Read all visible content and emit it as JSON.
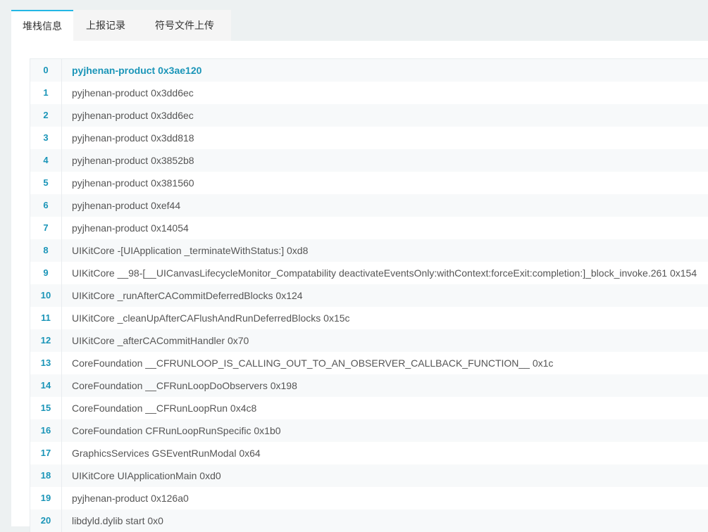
{
  "tabs": [
    {
      "label": "堆栈信息",
      "active": true
    },
    {
      "label": "上报记录",
      "active": false
    },
    {
      "label": "符号文件上传",
      "active": false
    }
  ],
  "colors": {
    "accent": "#23b7e5",
    "index_text": "#1a95b8",
    "page_bg": "#edf1f2",
    "row_alt": "#f7f9fa"
  },
  "stack": [
    {
      "index": "0",
      "frame": "pyjhenan-product 0x3ae120",
      "highlight": true
    },
    {
      "index": "1",
      "frame": "pyjhenan-product 0x3dd6ec"
    },
    {
      "index": "2",
      "frame": "pyjhenan-product 0x3dd6ec"
    },
    {
      "index": "3",
      "frame": "pyjhenan-product 0x3dd818"
    },
    {
      "index": "4",
      "frame": "pyjhenan-product 0x3852b8"
    },
    {
      "index": "5",
      "frame": "pyjhenan-product 0x381560"
    },
    {
      "index": "6",
      "frame": "pyjhenan-product 0xef44"
    },
    {
      "index": "7",
      "frame": "pyjhenan-product 0x14054"
    },
    {
      "index": "8",
      "frame": "UIKitCore -[UIApplication _terminateWithStatus:] 0xd8"
    },
    {
      "index": "9",
      "frame": "UIKitCore __98-[__UICanvasLifecycleMonitor_Compatability deactivateEventsOnly:withContext:forceExit:completion:]_block_invoke.261 0x154"
    },
    {
      "index": "10",
      "frame": "UIKitCore _runAfterCACommitDeferredBlocks 0x124"
    },
    {
      "index": "11",
      "frame": "UIKitCore _cleanUpAfterCAFlushAndRunDeferredBlocks 0x15c"
    },
    {
      "index": "12",
      "frame": "UIKitCore _afterCACommitHandler 0x70"
    },
    {
      "index": "13",
      "frame": "CoreFoundation __CFRUNLOOP_IS_CALLING_OUT_TO_AN_OBSERVER_CALLBACK_FUNCTION__ 0x1c"
    },
    {
      "index": "14",
      "frame": "CoreFoundation __CFRunLoopDoObservers 0x198"
    },
    {
      "index": "15",
      "frame": "CoreFoundation __CFRunLoopRun 0x4c8"
    },
    {
      "index": "16",
      "frame": "CoreFoundation CFRunLoopRunSpecific 0x1b0"
    },
    {
      "index": "17",
      "frame": "GraphicsServices GSEventRunModal 0x64"
    },
    {
      "index": "18",
      "frame": "UIKitCore UIApplicationMain 0xd0"
    },
    {
      "index": "19",
      "frame": "pyjhenan-product 0x126a0"
    },
    {
      "index": "20",
      "frame": "libdyld.dylib start 0x0"
    }
  ]
}
